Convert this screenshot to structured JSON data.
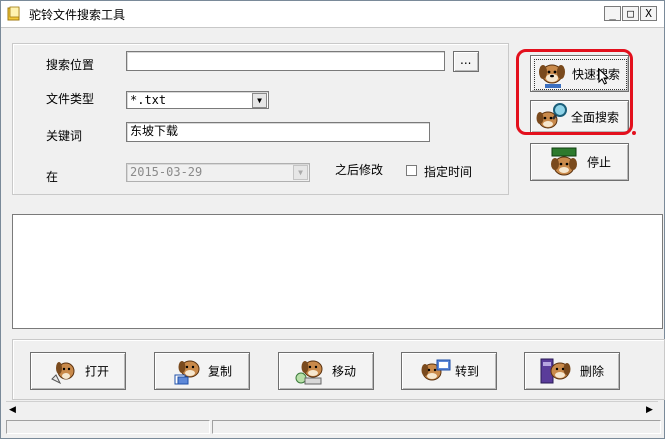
{
  "window": {
    "title": "驼铃文件搜索工具",
    "min_label": "_",
    "max_label": "□",
    "close_label": "X"
  },
  "search": {
    "location_label": "搜索位置",
    "location_value": "",
    "browse_label": "...",
    "filetype_label": "文件类型",
    "filetype_value": "*.txt",
    "keyword_label": "关键词",
    "keyword_value": "东坡下载",
    "date_prefix": "在",
    "date_value": "2015-03-29",
    "date_suffix": "之后修改",
    "specify_time_label": "指定时间",
    "specify_time_checked": false
  },
  "actions": {
    "quick_search": "快速搜索",
    "full_search": "全面搜索",
    "stop": "停止"
  },
  "file_buttons": {
    "open": "打开",
    "copy": "复制",
    "move": "移动",
    "goto": "转到",
    "delete": "删除"
  },
  "results": [],
  "colors": {
    "highlight": "#e3101d",
    "dog_brown": "#a0522d"
  }
}
